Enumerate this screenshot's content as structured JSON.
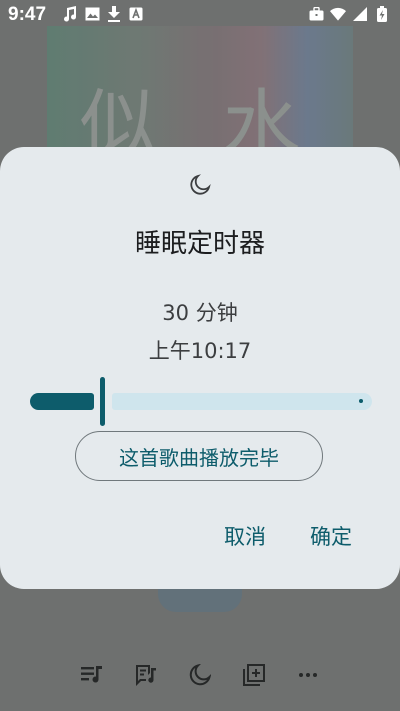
{
  "status_bar": {
    "time": "9:47",
    "left_icons": [
      "music-note-icon",
      "image-icon",
      "download-icon",
      "a-box-icon"
    ],
    "right_icons": [
      "briefcase-icon",
      "wifi-icon",
      "signal-icon",
      "battery-charging-icon"
    ]
  },
  "background": {
    "album_art_text": "似 水"
  },
  "dialog": {
    "icon": "moon-icon",
    "title": "睡眠定时器",
    "minutes_text": "30 分钟",
    "end_time_text": "上午10:17",
    "slider_value_fraction": 0.2,
    "song_end_label": "这首歌曲播放完毕",
    "cancel_label": "取消",
    "ok_label": "确定",
    "accent_color": "#0d5c6b",
    "track_color": "#cfe5ed"
  },
  "bottom_bar": {
    "icons": [
      "queue-music-icon",
      "lyrics-icon",
      "moon-icon",
      "add-to-playlist-icon",
      "more-icon"
    ]
  }
}
